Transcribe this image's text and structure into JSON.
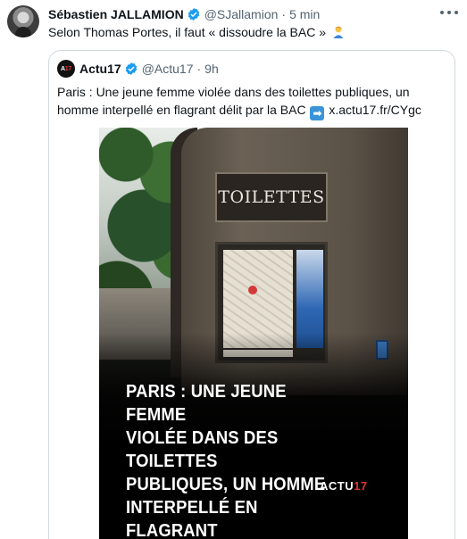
{
  "tweet": {
    "author_name": "Sébastien JALLAMION",
    "author_handle": "@SJallamion",
    "separator": "·",
    "time": "5 min",
    "text": "Selon Thomas Portes, il faut « dissoudre la BAC »"
  },
  "quoted": {
    "logo_text_a": "A",
    "logo_text_b": "17",
    "author_name": "Actu17",
    "author_handle": "@Actu17",
    "separator": "·",
    "time": "9h",
    "text_before_link": "Paris : Une jeune femme violée dans des toilettes publiques, un homme interpellé en flagrant délit par la BAC",
    "arrow": "➡",
    "link": "x.actu17.fr/CYgc",
    "media": {
      "sign": "TOILETTES",
      "headline": "PARIS : UNE JEUNE FEMME\nVIOLÉE DANS DES TOILETTES\nPUBLIQUES, UN HOMME\nINTERPELLÉ EN FLAGRANT\nDÉLIT PAR LA BAC",
      "brand_a": "ACTU",
      "brand_b": "17"
    }
  },
  "icons": [
    "verified-badge-icon",
    "more-options-icon",
    "person-emoji-icon"
  ],
  "colors": {
    "verified": "#1d9bf0",
    "muted": "#536471",
    "text": "#0f1419",
    "border": "#cfd9de",
    "brand_red": "#e4312b"
  }
}
